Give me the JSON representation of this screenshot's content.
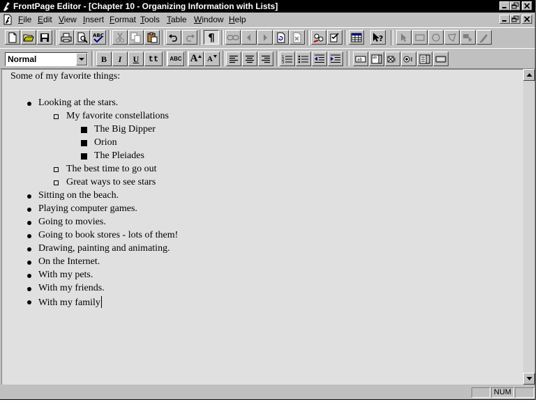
{
  "window": {
    "title": "FrontPage Editor - [Chapter 10 - Organizing Information with Lists]"
  },
  "menu": {
    "items": [
      {
        "accel": "F",
        "rest": "ile"
      },
      {
        "accel": "E",
        "rest": "dit"
      },
      {
        "accel": "V",
        "rest": "iew"
      },
      {
        "accel": "I",
        "rest": "nsert"
      },
      {
        "accel": "F",
        "rest": "ormat"
      },
      {
        "accel": "T",
        "rest": "ools"
      },
      {
        "accel": "T",
        "rest": "able"
      },
      {
        "accel": "W",
        "rest": "indow"
      },
      {
        "accel": "H",
        "rest": "elp"
      }
    ]
  },
  "toolbar": {
    "paragraph_mark": "¶",
    "spell_label": "ABC"
  },
  "format_bar": {
    "style_value": "Normal",
    "bold": "B",
    "italic": "I",
    "underline": "U",
    "typewriter": "tt",
    "text_color": "ABC",
    "grow_font": "A",
    "shrink_font": "A"
  },
  "document": {
    "intro": "Some of my favorite things:",
    "list": [
      {
        "level": 1,
        "text": "Looking at the stars."
      },
      {
        "level": 2,
        "text": "My favorite constellations"
      },
      {
        "level": 3,
        "text": "The Big Dipper"
      },
      {
        "level": 3,
        "text": "Orion"
      },
      {
        "level": 3,
        "text": "The Pleiades"
      },
      {
        "level": 2,
        "text": "The best time to go out"
      },
      {
        "level": 2,
        "text": "Great ways to see stars"
      },
      {
        "level": 1,
        "text": "Sitting on the beach."
      },
      {
        "level": 1,
        "text": "Playing computer games."
      },
      {
        "level": 1,
        "text": "Going to movies."
      },
      {
        "level": 1,
        "text": "Going to book stores - lots of them!"
      },
      {
        "level": 1,
        "text": "Drawing, painting and animating."
      },
      {
        "level": 1,
        "text": "On the Internet."
      },
      {
        "level": 1,
        "text": "With my pets."
      },
      {
        "level": 1,
        "text": "With my friends."
      },
      {
        "level": 1,
        "text": "With my family"
      }
    ]
  },
  "status": {
    "num": "NUM"
  }
}
